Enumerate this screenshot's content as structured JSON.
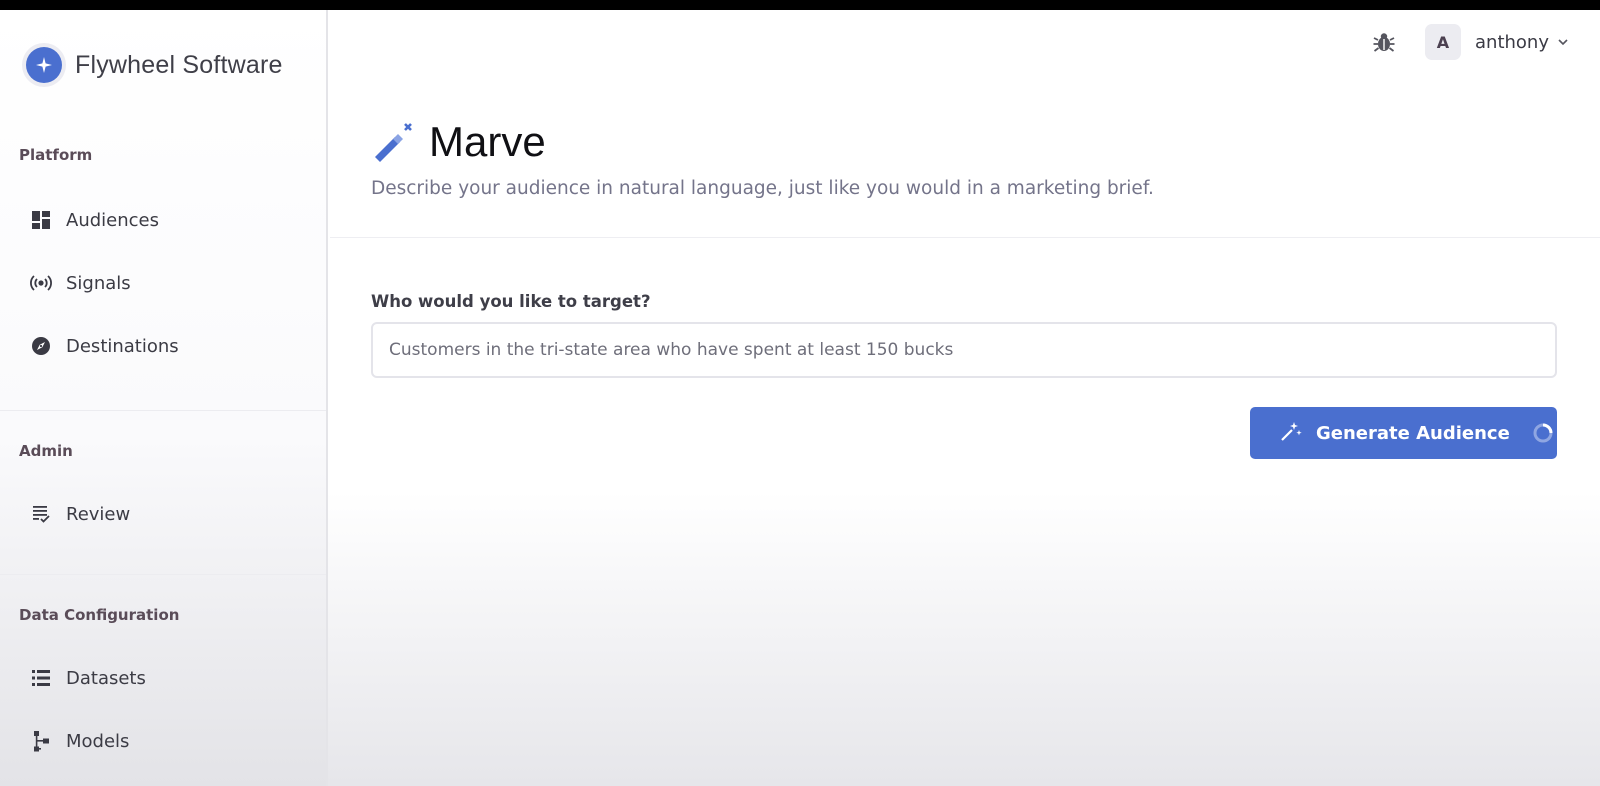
{
  "brand": {
    "name": "Flywheel Software",
    "logo_icon": "flywheel-logo-icon"
  },
  "sidebar": {
    "sections": [
      {
        "label": "Platform",
        "items": [
          {
            "label": "Audiences",
            "icon": "dashboard-icon"
          },
          {
            "label": "Signals",
            "icon": "broadcast-icon"
          },
          {
            "label": "Destinations",
            "icon": "compass-icon"
          }
        ]
      },
      {
        "label": "Admin",
        "items": [
          {
            "label": "Review",
            "icon": "checklist-icon"
          }
        ]
      },
      {
        "label": "Data Configuration",
        "items": [
          {
            "label": "Datasets",
            "icon": "list-icon"
          },
          {
            "label": "Models",
            "icon": "hierarchy-icon"
          }
        ]
      }
    ]
  },
  "topbar": {
    "bug_icon": "bug-icon",
    "user": {
      "avatar_initial": "A",
      "name": "anthony"
    }
  },
  "header": {
    "title": "Marve",
    "subtitle": "Describe your audience in natural language, just like you would in a marketing brief.",
    "icon": "magic-wand-icon"
  },
  "form": {
    "label": "Who would you like to target?",
    "input_value": "Customers in the tri-state area who have spent at least 150 bucks",
    "button_label": "Generate Audience",
    "button_icon": "sparkle-icon",
    "loading": true
  },
  "colors": {
    "accent": "#4a6fcf",
    "section_label": "#5a4c58",
    "text_muted": "#74748a"
  }
}
